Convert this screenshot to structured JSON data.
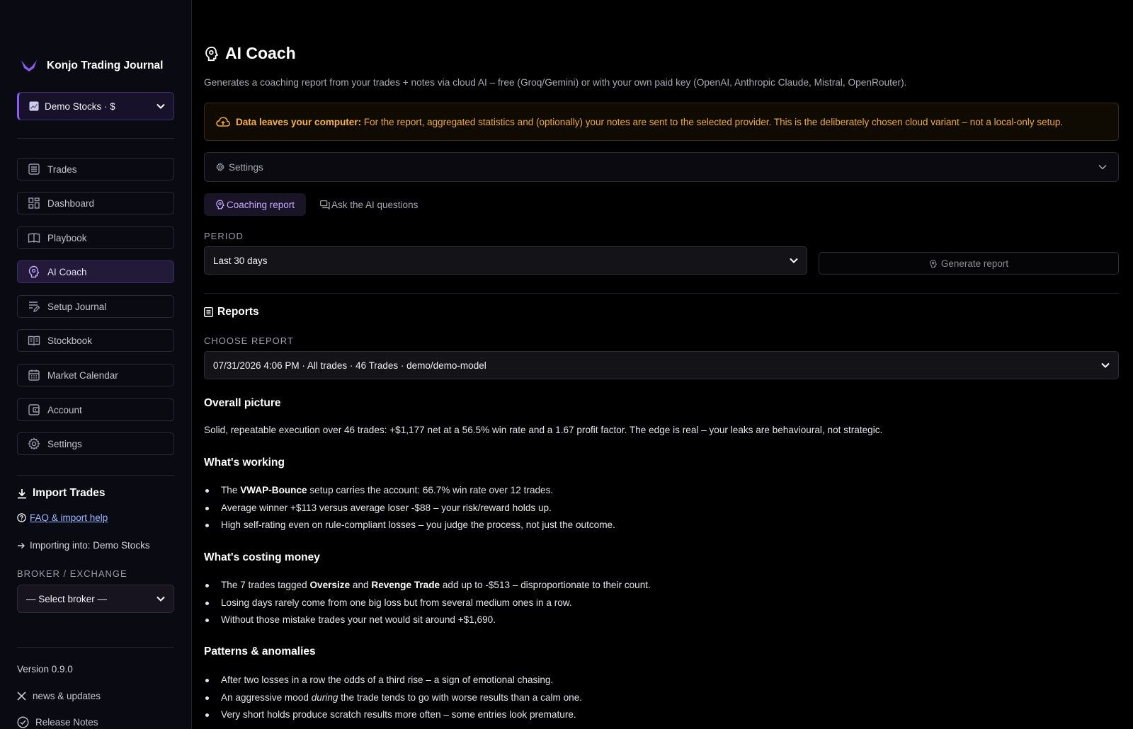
{
  "sidebar": {
    "brand": "Konjo Trading Journal",
    "account": "Demo Stocks · $",
    "nav": [
      {
        "label": "Trades"
      },
      {
        "label": "Dashboard"
      },
      {
        "label": "Playbook"
      },
      {
        "label": "AI Coach",
        "active": true
      },
      {
        "label": "Setup Journal"
      },
      {
        "label": "Stockbook"
      },
      {
        "label": "Market Calendar"
      },
      {
        "label": "Account"
      },
      {
        "label": "Settings"
      }
    ],
    "import_title": "Import Trades",
    "faq_link": "FAQ & import help",
    "importing_into": "Importing into: Demo Stocks",
    "broker_label": "BROKER / EXCHANGE",
    "broker_select": "— Select broker —",
    "version": "Version 0.9.0",
    "news_link": "news & updates",
    "release_notes": "Release Notes"
  },
  "main": {
    "title": "AI Coach",
    "subtitle": "Generates a coaching report from your trades + notes via cloud AI – free (Groq/Gemini) or with your own paid key (OpenAI, Anthropic Claude, Mistral, OpenRouter).",
    "warning_bold": "Data leaves your computer:",
    "warning_text": "For the report, aggregated statistics and (optionally) your notes are sent to the selected provider. This is the deliberately chosen cloud variant – not a local-only setup.",
    "settings_label": "Settings",
    "tabs": {
      "coaching": "Coaching report",
      "ask": "Ask the AI questions"
    },
    "period_label": "PERIOD",
    "period_value": "Last 30 days",
    "generate_btn": "Generate report",
    "reports_heading": "Reports",
    "choose_report_label": "CHOOSE REPORT",
    "report_value": "07/31/2026 4:06 PM · All trades · 46 Trades · demo/demo-model"
  },
  "report": {
    "overall_h": "Overall picture",
    "overall_p": "Solid, repeatable execution over 46 trades: +$1,177 net at a 56.5% win rate and a 1.67 profit factor. The edge is real – your leaks are behavioural, not strategic.",
    "working_h": "What's working",
    "working": {
      "b1_pre": "The ",
      "b1_bold": "VWAP-Bounce",
      "b1_post": " setup carries the account: 66.7% win rate over 12 trades.",
      "b2": "Average winner +$113 versus average loser -$88 – your risk/reward holds up.",
      "b3": "High self-rating even on rule-compliant losses – you judge the process, not just the outcome."
    },
    "costing_h": "What's costing money",
    "costing": {
      "b1_pre": "The 7 trades tagged ",
      "b1_bold1": "Oversize",
      "b1_mid": " and ",
      "b1_bold2": "Revenge Trade",
      "b1_post": " add up to -$513 – disproportionate to their count.",
      "b2": "Losing days rarely come from one big loss but from several medium ones in a row.",
      "b3": "Without those mistake trades your net would sit around +$1,690."
    },
    "patterns_h": "Patterns & anomalies",
    "patterns": {
      "b1": "After two losses in a row the odds of a third rise – a sign of emotional chasing.",
      "b2_pre": "An aggressive mood ",
      "b2_em": "during",
      "b2_post": " the trade tends to go with worse results than a calm one.",
      "b3": "Very short holds produce scratch results more often – some entries look premature."
    }
  }
}
